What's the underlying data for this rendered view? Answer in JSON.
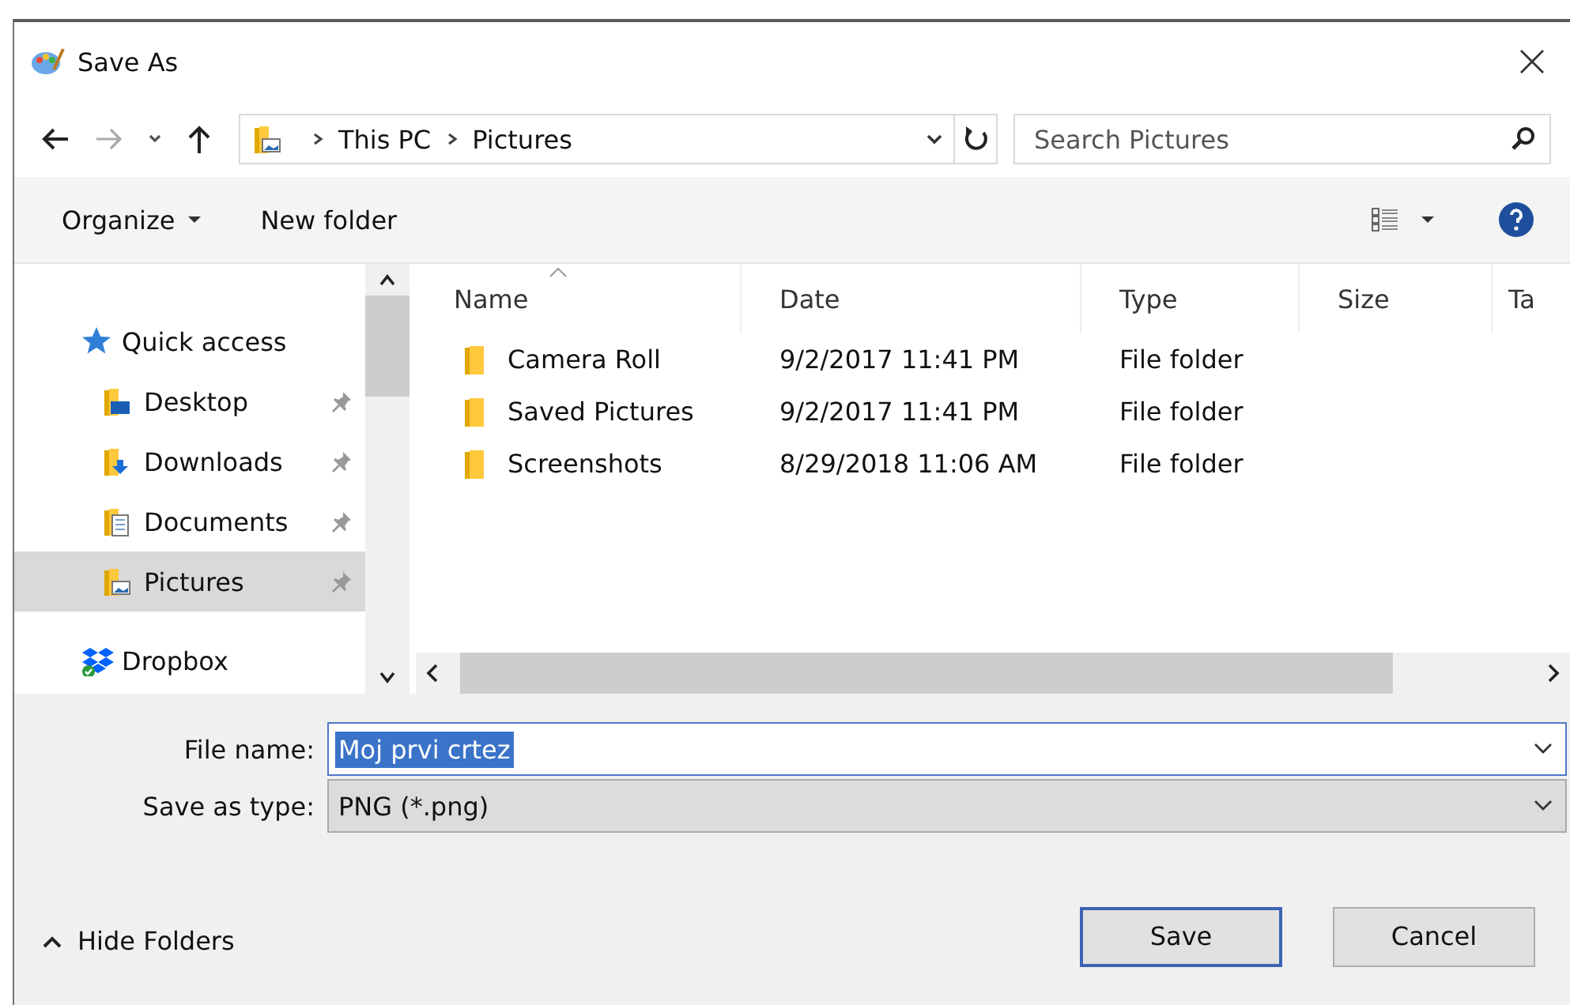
{
  "window": {
    "title": "Save As"
  },
  "nav": {
    "path": [
      "This PC",
      "Pictures"
    ],
    "search": {
      "placeholder": "Search Pictures"
    }
  },
  "toolbar": [
    {
      "label": "Organize",
      "dropdown": true
    },
    {
      "label": "New folder",
      "dropdown": false
    }
  ],
  "sidebar": {
    "items": [
      {
        "label": "Quick access",
        "kind": "star",
        "selected": false,
        "pinned": false,
        "children": [
          {
            "label": "Desktop",
            "kind": "desktop",
            "selected": false,
            "pinned": true
          },
          {
            "label": "Downloads",
            "kind": "downloads",
            "selected": false,
            "pinned": true
          },
          {
            "label": "Documents",
            "kind": "documents",
            "selected": false,
            "pinned": true
          },
          {
            "label": "Pictures",
            "kind": "pictures",
            "selected": true,
            "pinned": true
          }
        ]
      },
      {
        "label": "Dropbox",
        "kind": "dropbox",
        "selected": false,
        "pinned": false
      }
    ]
  },
  "table": {
    "columns": [
      {
        "label": "Name",
        "sorted": true
      },
      {
        "label": "Date",
        "sorted": false
      },
      {
        "label": "Type",
        "sorted": false
      },
      {
        "label": "Size",
        "sorted": false
      },
      {
        "label": "Ta",
        "sorted": false
      }
    ],
    "rows": [
      {
        "name": "Camera Roll",
        "date": "9/2/2017 11:41 PM",
        "type": "File folder"
      },
      {
        "name": "Saved Pictures",
        "date": "9/2/2017 11:41 PM",
        "type": "File folder"
      },
      {
        "name": "Screenshots",
        "date": "8/29/2018 11:06 AM",
        "type": "File folder"
      }
    ]
  },
  "form": [
    {
      "label": "File name:",
      "value": "Moj prvi crtez",
      "editable": true
    },
    {
      "label": "Save as type:",
      "value": "PNG (*.png)",
      "editable": false
    }
  ],
  "hide_folders": "Hide Folders",
  "buttons": [
    {
      "label": "Save",
      "default": true
    },
    {
      "label": "Cancel",
      "default": false
    }
  ]
}
